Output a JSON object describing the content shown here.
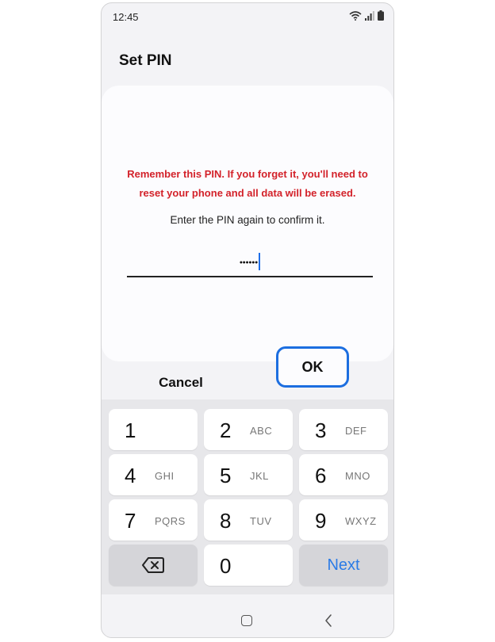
{
  "status_bar": {
    "time": "12:45",
    "icons": [
      "wifi-icon",
      "signal-icon",
      "battery-icon"
    ]
  },
  "page": {
    "title": "Set PIN"
  },
  "dialog": {
    "warning_line1": "Remember this PIN. If you forget it, you'll need to",
    "warning_line2": "reset your phone and all data will be erased.",
    "instruction": "Enter the PIN again to confirm it.",
    "pin_masked": "••••••"
  },
  "actions": {
    "cancel_label": "Cancel",
    "ok_label": "OK"
  },
  "keypad": {
    "keys": [
      {
        "num": "1",
        "letters": ""
      },
      {
        "num": "2",
        "letters": "ABC"
      },
      {
        "num": "3",
        "letters": "DEF"
      },
      {
        "num": "4",
        "letters": "GHI"
      },
      {
        "num": "5",
        "letters": "JKL"
      },
      {
        "num": "6",
        "letters": "MNO"
      },
      {
        "num": "7",
        "letters": "PQRS"
      },
      {
        "num": "8",
        "letters": "TUV"
      },
      {
        "num": "9",
        "letters": "WXYZ"
      },
      {
        "num": "0",
        "letters": ""
      }
    ],
    "next_label": "Next",
    "backspace_icon": "backspace-icon"
  },
  "nav_bar": {
    "icons": [
      "home-icon",
      "back-icon"
    ]
  },
  "colors": {
    "accent": "#1c6ee0",
    "warning": "#d3222a",
    "next": "#2b7be6"
  }
}
